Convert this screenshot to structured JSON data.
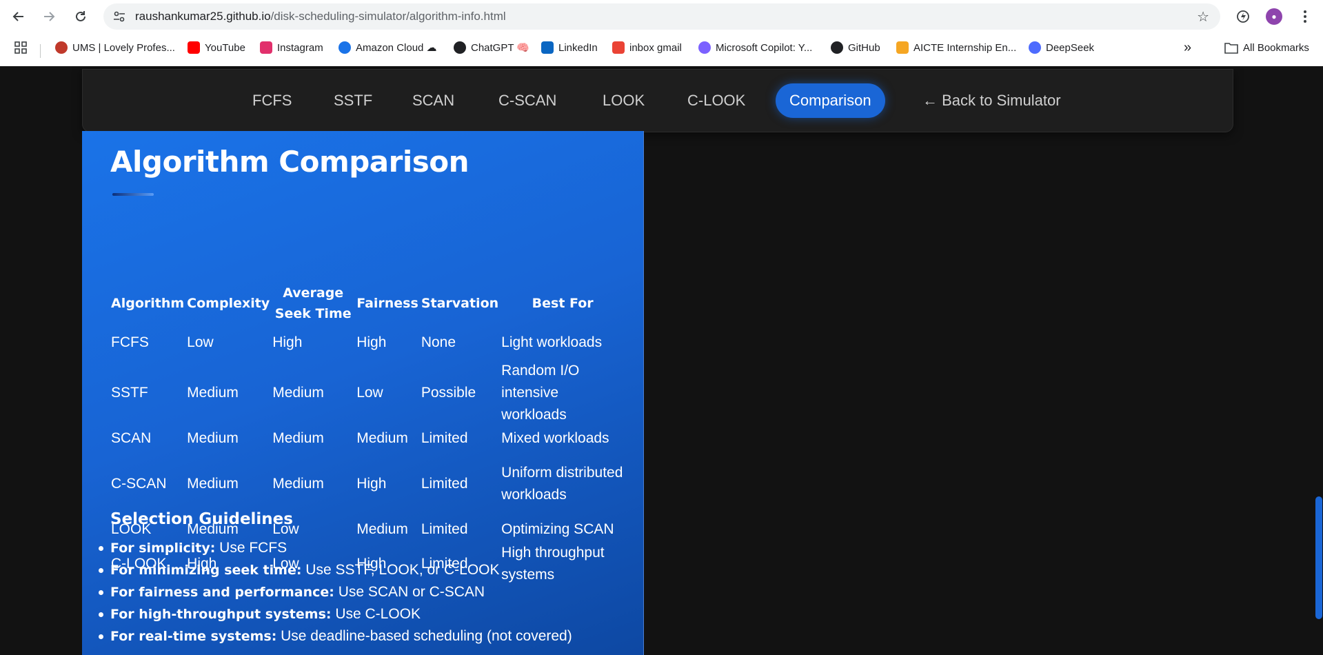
{
  "browser": {
    "url_host": "raushankumar25.github.io",
    "url_path": "/disk-scheduling-simulator/algorithm-info.html",
    "bookmarks": [
      {
        "label": "UMS | Lovely Profes...",
        "icon": "ums-icon",
        "color": "#c0392b"
      },
      {
        "label": "YouTube",
        "icon": "youtube-icon",
        "color": "#ff0000"
      },
      {
        "label": "Instagram",
        "icon": "instagram-icon",
        "color": "#e1306c"
      },
      {
        "label": "Amazon Cloud ☁",
        "icon": "amazon-cloud-icon",
        "color": "#1a73e8"
      },
      {
        "label": "ChatGPT 🧠",
        "icon": "chatgpt-icon",
        "color": "#202124"
      },
      {
        "label": "LinkedIn",
        "icon": "linkedin-icon",
        "color": "#0a66c2"
      },
      {
        "label": "inbox gmail",
        "icon": "gmail-icon",
        "color": "#ea4335"
      },
      {
        "label": "Microsoft Copilot: Y...",
        "icon": "copilot-icon",
        "color": "#7b61ff"
      },
      {
        "label": "GitHub",
        "icon": "github-icon",
        "color": "#202124"
      },
      {
        "label": "AICTE Internship En...",
        "icon": "aicte-icon",
        "color": "#f5a623"
      },
      {
        "label": "DeepSeek",
        "icon": "deepseek-icon",
        "color": "#4d6bfe"
      }
    ],
    "more_label": "»",
    "all_bookmarks": "All Bookmarks"
  },
  "nav": {
    "items": [
      "FCFS",
      "SSTF",
      "SCAN",
      "C-SCAN",
      "LOOK",
      "C-LOOK"
    ],
    "active": "Comparison",
    "back": "← Back to Simulator"
  },
  "section": {
    "title": "Algorithm Comparison",
    "table_headers": [
      "Algorithm",
      "Complexity",
      "Average Seek Time",
      "Fairness",
      "Starvation",
      "Best For"
    ],
    "rows": [
      [
        "FCFS",
        "Low",
        "High",
        "High",
        "None",
        "Light workloads"
      ],
      [
        "SSTF",
        "Medium",
        "Medium",
        "Low",
        "Possible",
        "Random I/O intensive workloads"
      ],
      [
        "SCAN",
        "Medium",
        "Medium",
        "Medium",
        "Limited",
        "Mixed workloads"
      ],
      [
        "C-SCAN",
        "Medium",
        "Medium",
        "High",
        "Limited",
        "Uniform distributed workloads"
      ],
      [
        "LOOK",
        "Medium",
        "Low",
        "Medium",
        "Limited",
        "Optimizing SCAN"
      ],
      [
        "C-LOOK",
        "High",
        "Low",
        "High",
        "Limited",
        "High throughput systems"
      ]
    ],
    "guidelines_title": "Selection Guidelines",
    "guidelines": [
      {
        "bold": "For simplicity:",
        "text": " Use FCFS"
      },
      {
        "bold": "For minimizing seek time:",
        "text": " Use SSTF, LOOK, or C-LOOK"
      },
      {
        "bold": "For fairness and performance:",
        "text": " Use SCAN or C-SCAN"
      },
      {
        "bold": "For high-throughput systems:",
        "text": " Use C-LOOK"
      },
      {
        "bold": "For real-time systems:",
        "text": " Use deadline-based scheduling (not covered)"
      }
    ]
  },
  "colors": {
    "accent": "#1a66d6",
    "card_top": "#1a73e8",
    "card_bottom": "#0d47a1",
    "page_bg": "#121212"
  }
}
